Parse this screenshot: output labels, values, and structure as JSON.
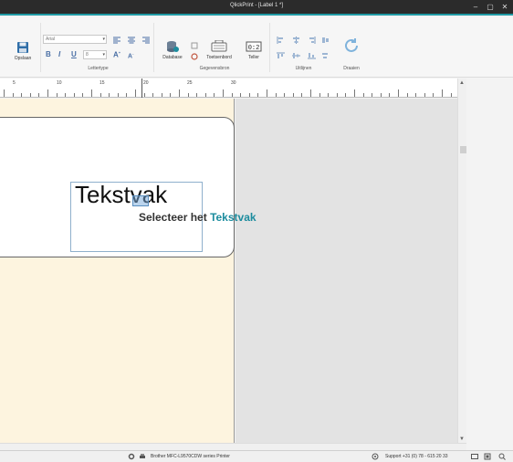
{
  "window": {
    "title": "QlickPrint - [Label 1 *]"
  },
  "ribbon": {
    "save_label": "Opslaan",
    "font_name": "Arial",
    "font_size": "8",
    "group_font_label": "Lettertype",
    "database_label": "Database",
    "keyboard_label": "Toetsenbord",
    "counter_label": "Teller",
    "group_datasource_label": "Gegevensbron",
    "group_align_label": "Uitlijnen",
    "group_rotate_label": "Draaien"
  },
  "ruler": {
    "numbers": [
      "5",
      "10",
      "15",
      "20",
      "25",
      "30"
    ]
  },
  "canvas": {
    "textbox_text": "Tekstvak",
    "tooltip_prefix": "Selecteer het",
    "tooltip_accent": "Tekstvak"
  },
  "status": {
    "printer": "Brother MFC-L9570CDW series Printer",
    "support": "Support +31 (0) 78 - 615 20 33"
  },
  "colors": {
    "accent": "#1c8c9e",
    "label_bg": "#fdf4df",
    "workspace": "#e3e3e3"
  }
}
